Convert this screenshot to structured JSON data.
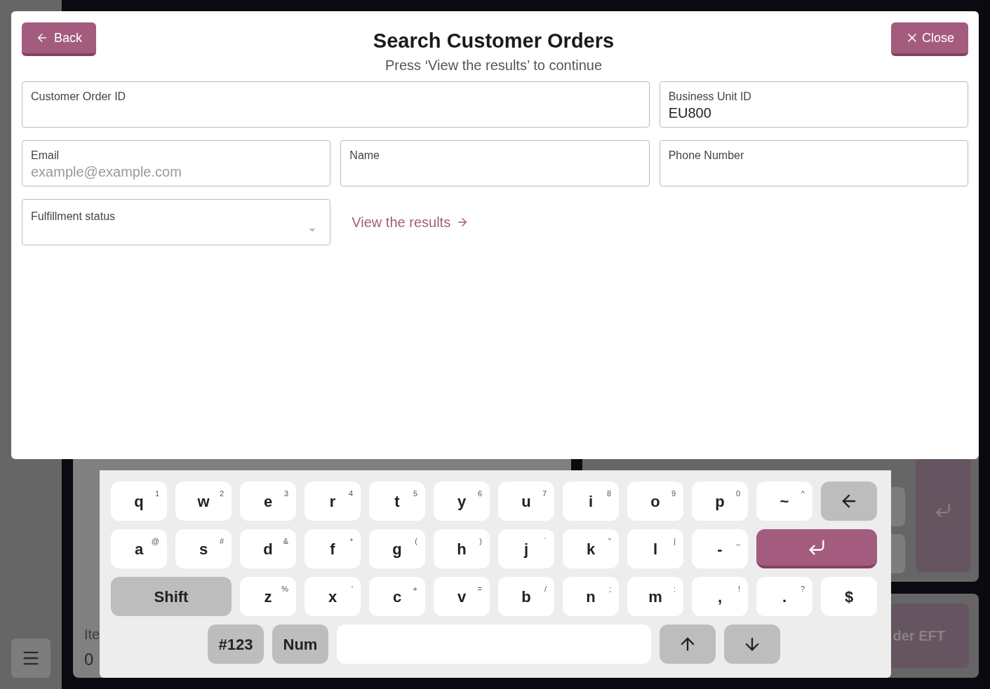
{
  "background": {
    "items_label": "Ite",
    "items_count": "0",
    "tender_button": "der EFT"
  },
  "header": {
    "back_button": "Back",
    "title": "Search Customer Orders",
    "subtitle": "Press ‘View the results’ to continue",
    "close_button": "Close"
  },
  "fields": [
    {
      "kind": "text",
      "label": "Customer Order ID"
    },
    {
      "kind": "text",
      "label": "Business Unit ID",
      "value": "EU800"
    },
    {
      "kind": "text",
      "label": "Email",
      "placeholder": "example@example.com"
    },
    {
      "kind": "text",
      "label": "Name"
    },
    {
      "kind": "text",
      "label": "Phone Number"
    },
    {
      "kind": "select",
      "label": "Fulfillment status"
    }
  ],
  "results_link": "View the results",
  "keyboard": {
    "key_rows": [
      {
        "keys": [
          {
            "kind": "char",
            "label": "q",
            "alt": "1"
          },
          {
            "kind": "char",
            "label": "w",
            "alt": "2"
          },
          {
            "kind": "char",
            "label": "e",
            "alt": "3"
          },
          {
            "kind": "char",
            "label": "r",
            "alt": "4"
          },
          {
            "kind": "char",
            "label": "t",
            "alt": "5"
          },
          {
            "kind": "char",
            "label": "y",
            "alt": "6"
          },
          {
            "kind": "char",
            "label": "u",
            "alt": "7"
          },
          {
            "kind": "char",
            "label": "i",
            "alt": "8"
          },
          {
            "kind": "char",
            "label": "o",
            "alt": "9"
          },
          {
            "kind": "char",
            "label": "p",
            "alt": "0"
          },
          {
            "kind": "char",
            "label": "~",
            "alt": "^"
          },
          {
            "kind": "backspace"
          }
        ]
      },
      {
        "keys": [
          {
            "kind": "char",
            "label": "a",
            "alt": "@"
          },
          {
            "kind": "char",
            "label": "s",
            "alt": "#"
          },
          {
            "kind": "char",
            "label": "d",
            "alt": "&"
          },
          {
            "kind": "char",
            "label": "f",
            "alt": "*"
          },
          {
            "kind": "char",
            "label": "g",
            "alt": "("
          },
          {
            "kind": "char",
            "label": "h",
            "alt": ")"
          },
          {
            "kind": "char",
            "label": "j",
            "alt": "`"
          },
          {
            "kind": "char",
            "label": "k",
            "alt": "\""
          },
          {
            "kind": "char",
            "label": "l",
            "alt": "|"
          },
          {
            "kind": "char",
            "label": "-",
            "alt": "_"
          },
          {
            "kind": "enter"
          }
        ]
      },
      {
        "keys": [
          {
            "kind": "shift",
            "label": "Shift"
          },
          {
            "kind": "char",
            "label": "z",
            "alt": "%"
          },
          {
            "kind": "char",
            "label": "x",
            "alt": "'"
          },
          {
            "kind": "char",
            "label": "c",
            "alt": "+"
          },
          {
            "kind": "char",
            "label": "v",
            "alt": "="
          },
          {
            "kind": "char",
            "label": "b",
            "alt": "/"
          },
          {
            "kind": "char",
            "label": "n",
            "alt": ";"
          },
          {
            "kind": "char",
            "label": "m",
            "alt": ":"
          },
          {
            "kind": "char",
            "label": ",",
            "alt": "!"
          },
          {
            "kind": "char",
            "label": ".",
            "alt": "?"
          },
          {
            "kind": "char",
            "label": "$"
          }
        ]
      },
      {
        "keys": [
          {
            "kind": "mode",
            "label": "#123"
          },
          {
            "kind": "mode",
            "label": "Num"
          },
          {
            "kind": "space"
          },
          {
            "kind": "up"
          },
          {
            "kind": "down"
          }
        ]
      }
    ]
  }
}
